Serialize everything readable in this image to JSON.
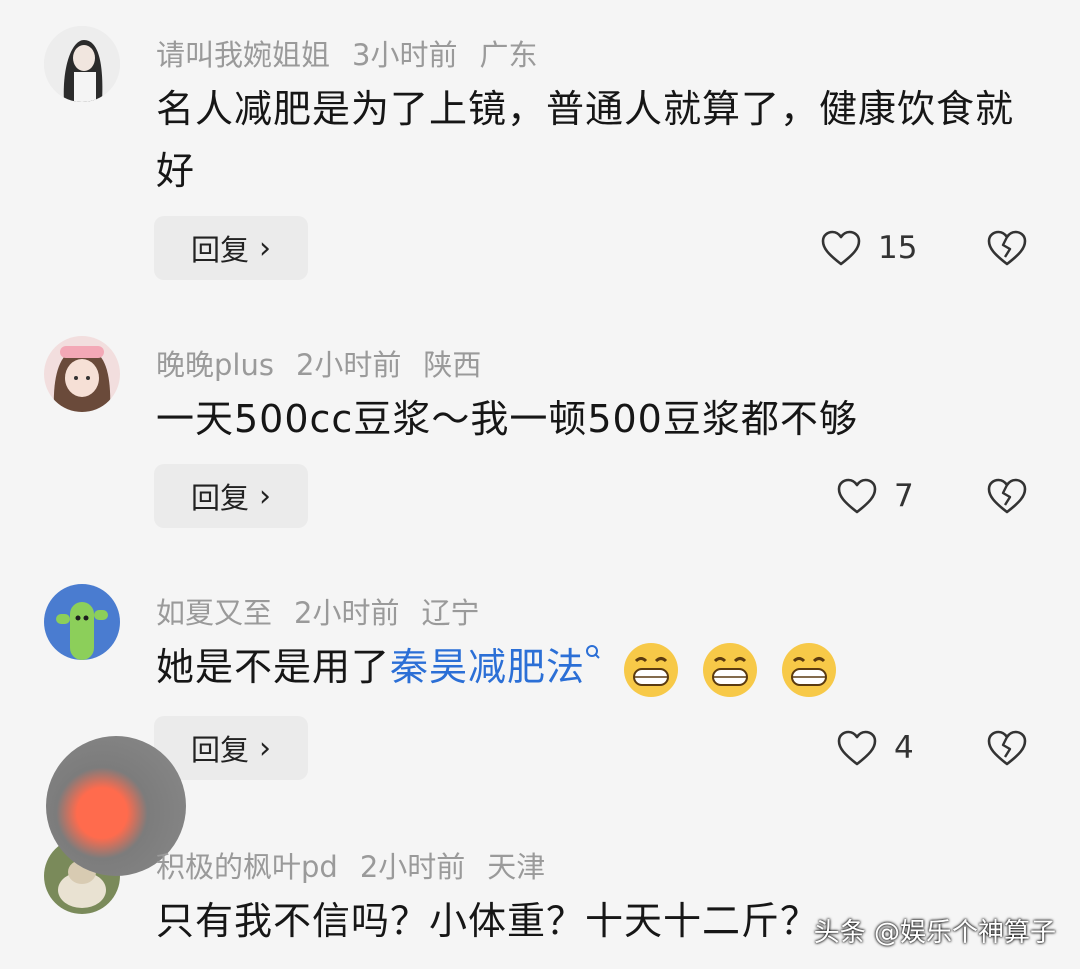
{
  "comments": [
    {
      "username": "请叫我婉姐姐",
      "time": "3小时前",
      "location": "广东",
      "text": "名人减肥是为了上镜，普通人就算了，健康饮食就好",
      "reply_label": "回复",
      "likes": "15"
    },
    {
      "username": "晚晚plus",
      "time": "2小时前",
      "location": "陕西",
      "text": "一天500cc豆浆～我一顿500豆浆都不够",
      "reply_label": "回复",
      "likes": "7"
    },
    {
      "username": "如夏又至",
      "time": "2小时前",
      "location": "辽宁",
      "text_prefix": "她是不是用了",
      "link_text": "秦昊减肥法",
      "reply_label": "回复",
      "likes": "4"
    },
    {
      "username": "积极的枫叶pd",
      "time": "2小时前",
      "location": "天津",
      "text": "只有我不信吗？小体重？十天十二斤？"
    }
  ],
  "watermark": "头条 @娱乐个神算子",
  "icons": {
    "like": "heart-outline-icon",
    "dislike": "broken-heart-icon",
    "chevron": "chevron-right-icon",
    "search": "search-icon",
    "emoji": "grinning-emoji-icon"
  },
  "colors": {
    "background": "#f5f5f5",
    "link": "#2b6fd6",
    "meta": "#9a9a9a"
  }
}
